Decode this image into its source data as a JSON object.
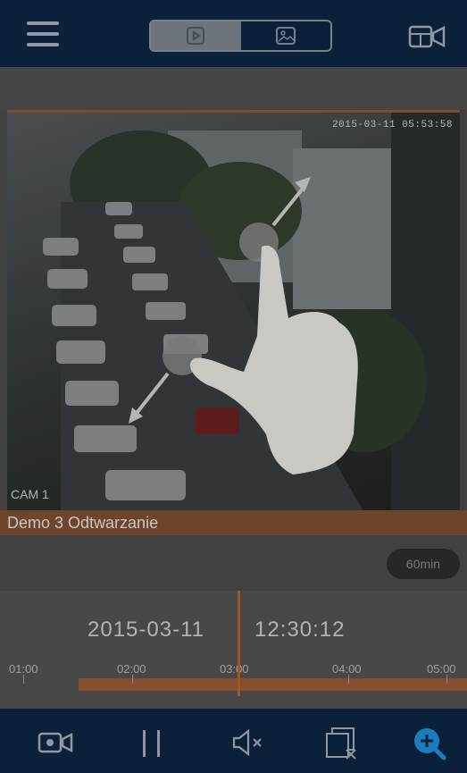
{
  "header": {
    "mode_tabs": [
      {
        "icon": "play-video-icon",
        "active": true
      },
      {
        "icon": "image-gallery-icon",
        "active": false
      }
    ],
    "right_icon": "multi-camera-icon",
    "menu_icon": "hamburger-menu-icon"
  },
  "video": {
    "timestamp": "2015-03-11 05:53:58",
    "camera_label": "CAM 1",
    "gesture_hint": "pinch-zoom-gesture"
  },
  "playback": {
    "title": "Demo 3  Odtwarzanie",
    "interval_label": "60min",
    "date": "2015-03-11",
    "time": "12:30:12",
    "ticks": [
      "01:00",
      "02:00",
      "03:00",
      "04:00",
      "05:00"
    ]
  },
  "toolbar": {
    "icons": [
      "record-camera-icon",
      "pause-icon",
      "mute-icon",
      "close-window-icon",
      "zoom-in-icon"
    ]
  },
  "colors": {
    "navbar": "#0d2541",
    "accent": "#b8642b",
    "active_icon": "#1e90d6"
  }
}
